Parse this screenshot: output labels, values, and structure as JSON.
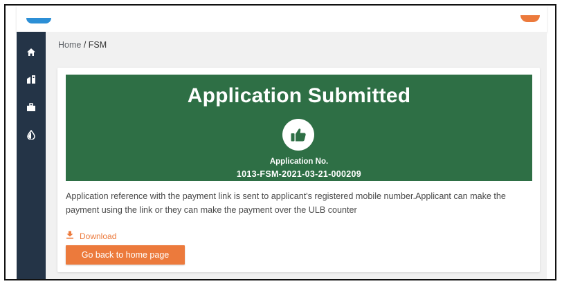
{
  "breadcrumb": {
    "home": "Home",
    "separator": " / ",
    "current": "FSM"
  },
  "sidebar": {
    "items": [
      {
        "icon": "home-icon",
        "active": true
      },
      {
        "icon": "city-icon",
        "active": false
      },
      {
        "icon": "briefcase-icon",
        "active": false
      },
      {
        "icon": "water-drop-icon",
        "active": false
      }
    ]
  },
  "banner": {
    "title": "Application Submitted",
    "icon": "thumbs-up-icon",
    "app_no_label": "Application No.",
    "app_no": "1013-FSM-2021-03-21-000209"
  },
  "message": "Application reference with the payment link is sent to applicant's registered mobile number.Applicant can make the payment using the link or they can make the payment over the ULB counter",
  "download": {
    "label": "Download",
    "icon": "download-icon"
  },
  "home_button": {
    "label": "Go back to home page"
  },
  "colors": {
    "accent": "#ec7a3c",
    "banner": "#2e6f45",
    "sidebar": "#243447",
    "logo": "#2c8fd6"
  }
}
